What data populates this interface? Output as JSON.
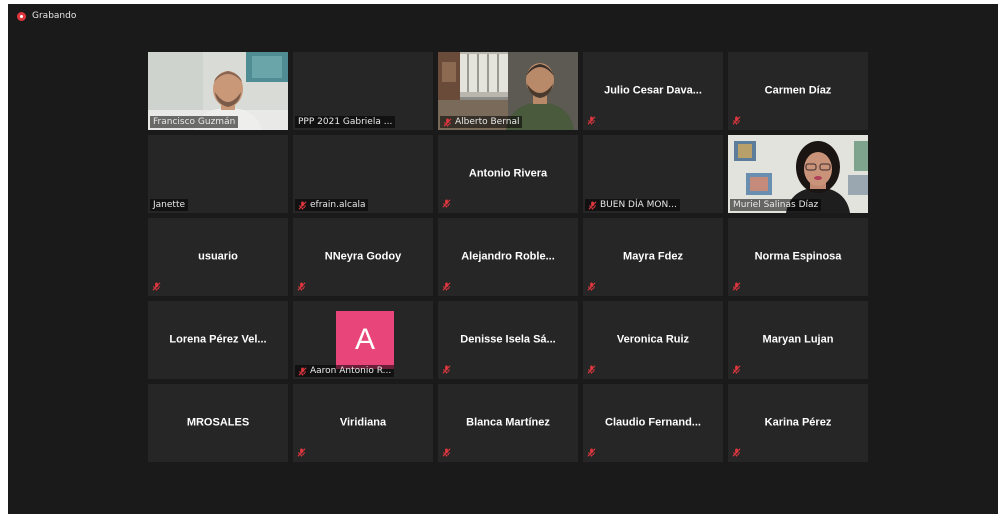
{
  "recording": {
    "label": "Grabando"
  },
  "participants": [
    {
      "name": "Francisco Guzmán",
      "display": "label",
      "muted": false,
      "video": "francisco"
    },
    {
      "name": "PPP 2021 Gabriela ...",
      "display": "label",
      "muted": false,
      "video": "none"
    },
    {
      "name": "Alberto Bernal",
      "display": "label",
      "muted": true,
      "video": "alberto"
    },
    {
      "name": "Julio Cesar Dava...",
      "display": "center",
      "muted": true,
      "video": "none"
    },
    {
      "name": "Carmen Díaz",
      "display": "center",
      "muted": true,
      "video": "none"
    },
    {
      "name": "Janette",
      "display": "label",
      "muted": false,
      "video": "none"
    },
    {
      "name": "efrain.alcala",
      "display": "label",
      "muted": true,
      "video": "none"
    },
    {
      "name": "Antonio Rivera",
      "display": "center",
      "muted": true,
      "video": "none"
    },
    {
      "name": "BUEN DÍA MON...",
      "display": "label",
      "muted": true,
      "video": "none"
    },
    {
      "name": "Muriel Salinas Díaz",
      "display": "label",
      "muted": false,
      "video": "muriel",
      "active_speaker": true
    },
    {
      "name": "usuario",
      "display": "center",
      "muted": true,
      "video": "none"
    },
    {
      "name": "NNeyra Godoy",
      "display": "center",
      "muted": true,
      "video": "none"
    },
    {
      "name": "Alejandro  Roble...",
      "display": "center",
      "muted": true,
      "video": "none"
    },
    {
      "name": "Mayra Fdez",
      "display": "center",
      "muted": true,
      "video": "none"
    },
    {
      "name": "Norma Espinosa",
      "display": "center",
      "muted": true,
      "video": "none"
    },
    {
      "name": "Lorena  Pérez Vel...",
      "display": "center",
      "muted": false,
      "video": "none"
    },
    {
      "name": "Aaron Antonio R...",
      "display": "label",
      "muted": true,
      "video": "avatar",
      "avatar_letter": "A"
    },
    {
      "name": "Denisse Isela Sá...",
      "display": "center",
      "muted": true,
      "video": "none"
    },
    {
      "name": "Veronica Ruiz",
      "display": "center",
      "muted": true,
      "video": "none"
    },
    {
      "name": "Maryan Lujan",
      "display": "center",
      "muted": true,
      "video": "none"
    },
    {
      "name": "MROSALES",
      "display": "center",
      "muted": false,
      "video": "none"
    },
    {
      "name": "Viridiana",
      "display": "center",
      "muted": true,
      "video": "none"
    },
    {
      "name": "Blanca Martínez",
      "display": "center",
      "muted": true,
      "video": "none"
    },
    {
      "name": "Claudio  Fernand...",
      "display": "center",
      "muted": true,
      "video": "none"
    },
    {
      "name": "Karina Pérez",
      "display": "center",
      "muted": true,
      "video": "none"
    }
  ],
  "colors": {
    "background": "#1a1a1a",
    "tile": "#262626",
    "active_border": "#a6d64c",
    "mute_icon": "#e0373f",
    "avatar_bg": "#e8457a"
  }
}
